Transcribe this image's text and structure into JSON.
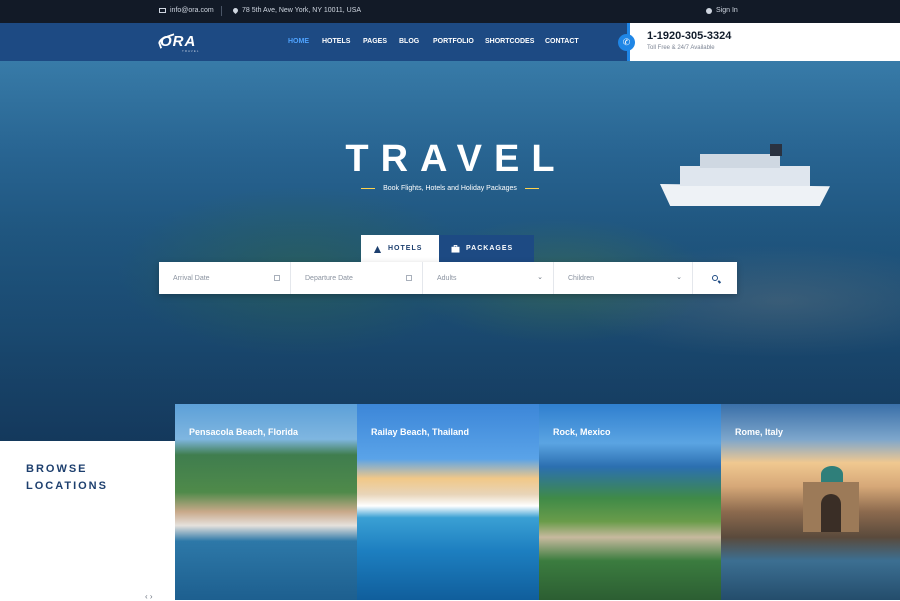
{
  "topbar": {
    "email": "info@ora.com",
    "address": "78 5th Ave, New York, NY 10011, USA",
    "signin": "Sign In"
  },
  "header": {
    "logo": "ORA",
    "logo_sub": "TRAVEL",
    "nav": [
      {
        "label": "HOME",
        "active": true
      },
      {
        "label": "HOTELS",
        "active": false
      },
      {
        "label": "PAGES",
        "active": false
      },
      {
        "label": "BLOG",
        "active": false
      },
      {
        "label": "PORTFOLIO",
        "active": false
      },
      {
        "label": "SHORTCODES",
        "active": false
      },
      {
        "label": "CONTACT",
        "active": false
      }
    ],
    "phone": "1-1920-305-3324",
    "phone_sub": "Toll Free & 24/7 Available"
  },
  "hero": {
    "title": "TRAVEL",
    "subtitle": "Book Flights, Hotels and Holiday Packages"
  },
  "search": {
    "tabs": [
      {
        "label": "HOTELS",
        "icon": "building-icon",
        "active": true
      },
      {
        "label": "PACKAGES",
        "icon": "suitcase-icon",
        "active": false
      }
    ],
    "fields": {
      "arrival": "Arrival Date",
      "departure": "Departure Date",
      "adults": "Adults",
      "children": "Children"
    }
  },
  "browse": {
    "title": "BROWSE LOCATIONS",
    "locations": [
      "Pensacola Beach, Florida",
      "Railay Beach, Thailand",
      "Rock, Mexico",
      "Rome, Italy"
    ]
  },
  "colors": {
    "nav_bg": "#1d4a83",
    "accent": "#1f86e6",
    "topbar_bg": "#121a27",
    "heading": "#1d3f6e"
  }
}
